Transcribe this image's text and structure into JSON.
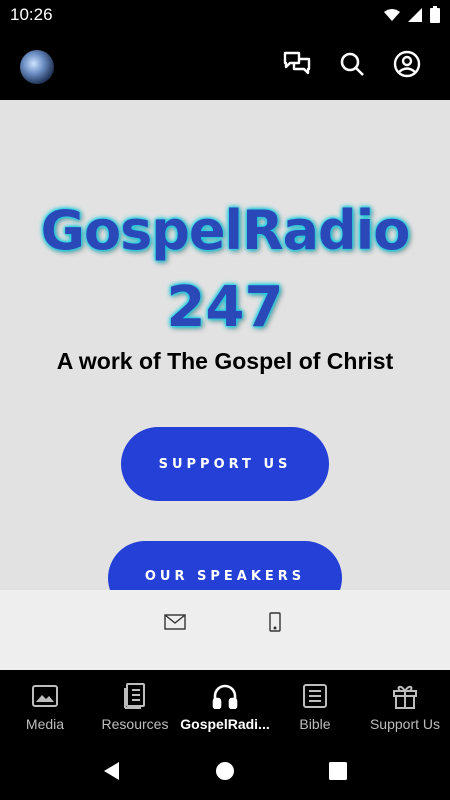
{
  "status_bar": {
    "time": "10:26"
  },
  "app_bar": {
    "icons": [
      "app-logo",
      "chat-icon",
      "search-icon",
      "account-icon"
    ]
  },
  "hero": {
    "title": "GospelRadio",
    "number": "247",
    "tagline": "A work of The Gospel of Christ",
    "colors": {
      "title": "#2a48b8",
      "glow": "#17d3e6",
      "background": "#e2e2e2"
    }
  },
  "buttons": {
    "support": "SUPPORT US",
    "speakers": "OUR SPEAKERS",
    "color": "#2540d6"
  },
  "footer": {
    "icons": [
      "mail-icon",
      "phone-icon"
    ]
  },
  "bottom_nav": {
    "items": [
      {
        "label": "Media",
        "icon": "image-icon"
      },
      {
        "label": "Resources",
        "icon": "book-icon"
      },
      {
        "label": "GospelRadi...",
        "icon": "headphones-icon",
        "active": true
      },
      {
        "label": "Bible",
        "icon": "bible-icon"
      },
      {
        "label": "Support Us",
        "icon": "gift-icon"
      }
    ]
  },
  "system_nav": {
    "icons": [
      "back-icon",
      "home-icon",
      "recents-icon"
    ]
  }
}
